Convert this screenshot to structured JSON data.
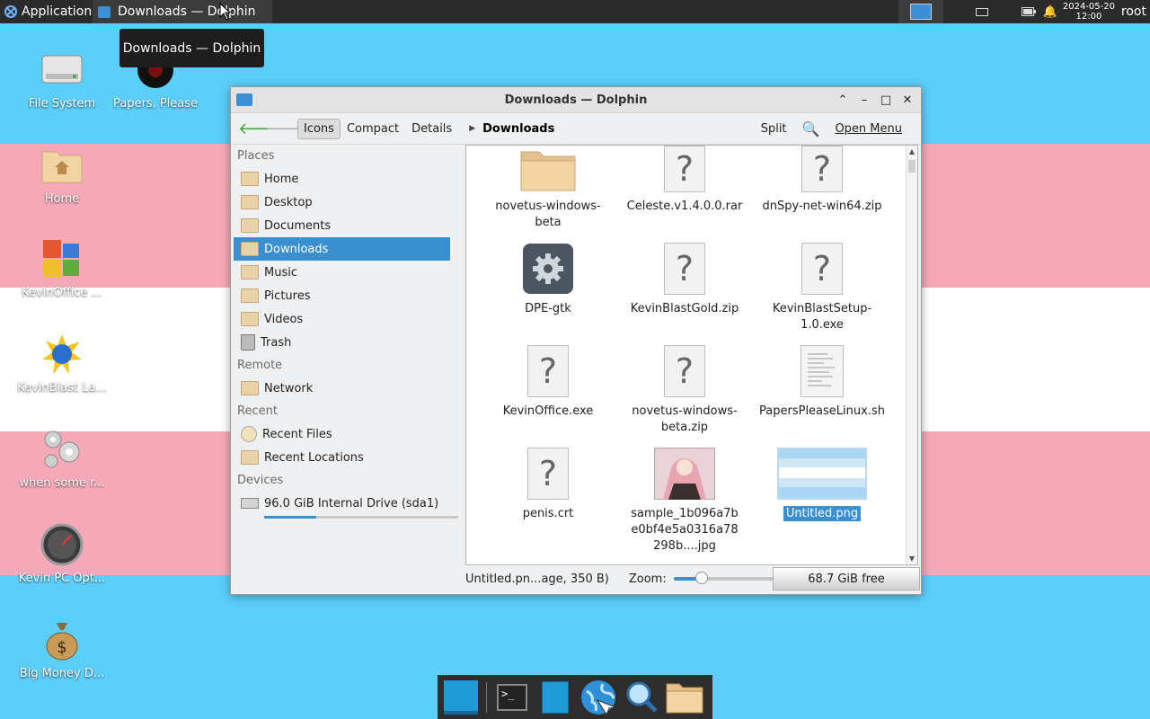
{
  "top_panel": {
    "applications_label": "Applications",
    "active_task_label": "Downloads — Dolphin",
    "clock_date": "2024-05-20",
    "clock_time": "12:00",
    "user": "root"
  },
  "tooltip": "Downloads — Dolphin",
  "desktop_icons": [
    {
      "label": "File System"
    },
    {
      "label": "Papers, Please"
    },
    {
      "label": "Home"
    },
    {
      "label": "KevinOffice ..."
    },
    {
      "label": "KevinBlast La..."
    },
    {
      "label": "when some r..."
    },
    {
      "label": "Kevin PC Opt..."
    },
    {
      "label": "Big Money D..."
    }
  ],
  "window": {
    "title": "Downloads — Dolphin",
    "toolbar": {
      "icons": "Icons",
      "compact": "Compact",
      "details": "Details",
      "breadcrumb": "Downloads",
      "split": "Split",
      "open_menu": "Open Menu"
    },
    "places": {
      "section_places": "Places",
      "home": "Home",
      "desktop": "Desktop",
      "documents": "Documents",
      "downloads": "Downloads",
      "music": "Music",
      "pictures": "Pictures",
      "videos": "Videos",
      "trash": "Trash",
      "section_remote": "Remote",
      "network": "Network",
      "section_recent": "Recent",
      "recent_files": "Recent Files",
      "recent_locations": "Recent Locations",
      "section_devices": "Devices",
      "drive": "96.0 GiB Internal Drive (sda1)"
    },
    "files": [
      {
        "name": "novetus-windows-beta",
        "icon": "folder"
      },
      {
        "name": "Celeste.v1.4.0.0.rar",
        "icon": "unknown"
      },
      {
        "name": "dnSpy-net-win64.zip",
        "icon": "unknown"
      },
      {
        "name": "DPE-gtk",
        "icon": "executable-gear"
      },
      {
        "name": "KevinBlastGold.zip",
        "icon": "unknown"
      },
      {
        "name": "KevinBlastSetup-1.0.exe",
        "icon": "unknown"
      },
      {
        "name": "KevinOffice.exe",
        "icon": "unknown"
      },
      {
        "name": "novetus-windows-beta.zip",
        "icon": "unknown"
      },
      {
        "name": "PapersPleaseLinux.sh",
        "icon": "script"
      },
      {
        "name": "penis.crt",
        "icon": "unknown"
      },
      {
        "name": "sample_1b096a7be0bf4e5a0316a78298b....jpg",
        "icon": "image-thumbnail"
      },
      {
        "name": "Untitled.png",
        "icon": "image-thumbnail-flag"
      }
    ],
    "status": {
      "selection": "Untitled.pn...age, 350 B)",
      "zoom_label": "Zoom:",
      "free_space": "68.7 GiB free"
    }
  },
  "colors": {
    "wallpaper_blue": "#5bcefa",
    "wallpaper_pink": "#f5a9b8",
    "wallpaper_white": "#ffffff",
    "selection": "#3a8fd1"
  }
}
